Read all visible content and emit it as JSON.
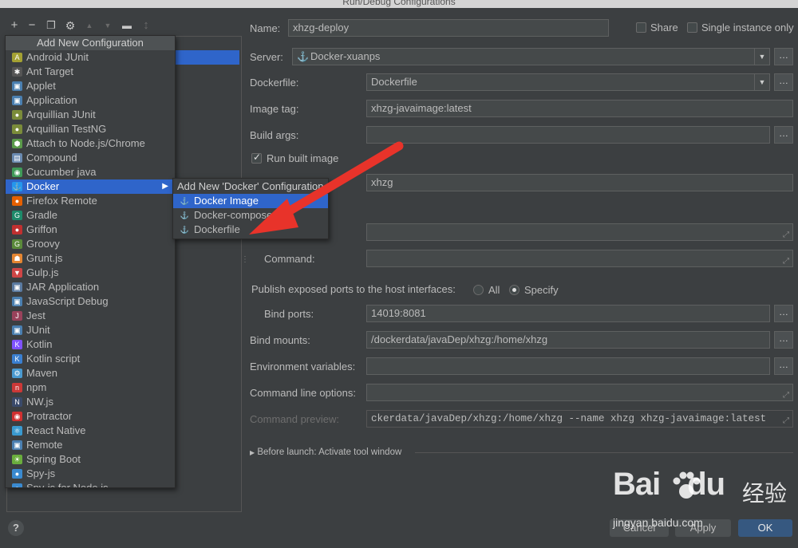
{
  "window": {
    "title": "Run/Debug Configurations"
  },
  "toolbar": {
    "items": [
      {
        "name": "add-icon",
        "glyph": "+"
      },
      {
        "name": "remove-icon",
        "glyph": "−"
      },
      {
        "name": "copy-icon",
        "glyph": "❐"
      },
      {
        "name": "wrench-icon",
        "glyph": "⚙"
      },
      {
        "name": "arrow-up-icon",
        "glyph": "▲"
      },
      {
        "name": "arrow-down-icon",
        "glyph": "▼"
      },
      {
        "name": "folder-icon",
        "glyph": "▬"
      },
      {
        "name": "sort-icon",
        "glyph": "↕"
      }
    ]
  },
  "popup": {
    "header": "Add New Configuration",
    "items": [
      {
        "label": "Android JUnit",
        "icon": "android-junit-icon",
        "color": "#a4a133",
        "glyph": "A"
      },
      {
        "label": "Ant Target",
        "icon": "ant-icon",
        "color": "#555555",
        "glyph": "✱"
      },
      {
        "label": "Applet",
        "icon": "applet-icon",
        "color": "#4a7fb0",
        "glyph": "▣"
      },
      {
        "label": "Application",
        "icon": "application-icon",
        "color": "#4a7fb0",
        "glyph": "▣"
      },
      {
        "label": "Arquillian JUnit",
        "icon": "arquillian-icon",
        "color": "#7b8c3a",
        "glyph": "●"
      },
      {
        "label": "Arquillian TestNG",
        "icon": "arquillian-testng-icon",
        "color": "#7b8c3a",
        "glyph": "●"
      },
      {
        "label": "Attach to Node.js/Chrome",
        "icon": "nodejs-icon",
        "color": "#5a9a4a",
        "glyph": "⬢"
      },
      {
        "label": "Compound",
        "icon": "compound-icon",
        "color": "#6a8ab0",
        "glyph": "▤"
      },
      {
        "label": "Cucumber java",
        "icon": "cucumber-icon",
        "color": "#3f9a58",
        "glyph": "◉"
      },
      {
        "label": "Docker",
        "icon": "docker-icon",
        "color": "#2496ed",
        "glyph": "⚓",
        "selected": true,
        "hasSubmenu": true
      },
      {
        "label": "Firefox Remote",
        "icon": "firefox-icon",
        "color": "#e66000",
        "glyph": "●"
      },
      {
        "label": "Gradle",
        "icon": "gradle-icon",
        "color": "#1d8a6a",
        "glyph": "G"
      },
      {
        "label": "Griffon",
        "icon": "griffon-icon",
        "color": "#c03030",
        "glyph": "●"
      },
      {
        "label": "Groovy",
        "icon": "groovy-icon",
        "color": "#5a8a3a",
        "glyph": "G"
      },
      {
        "label": "Grunt.js",
        "icon": "grunt-icon",
        "color": "#e48632",
        "glyph": "☗"
      },
      {
        "label": "Gulp.js",
        "icon": "gulp-icon",
        "color": "#cf4646",
        "glyph": "▼"
      },
      {
        "label": "JAR Application",
        "icon": "jar-icon",
        "color": "#5a7aa0",
        "glyph": "▣"
      },
      {
        "label": "JavaScript Debug",
        "icon": "js-debug-icon",
        "color": "#4a7fb0",
        "glyph": "▣"
      },
      {
        "label": "Jest",
        "icon": "jest-icon",
        "color": "#99425b",
        "glyph": "J"
      },
      {
        "label": "JUnit",
        "icon": "junit-icon",
        "color": "#4a7fb0",
        "glyph": "▣"
      },
      {
        "label": "Kotlin",
        "icon": "kotlin-icon",
        "color": "#7f52ff",
        "glyph": "K"
      },
      {
        "label": "Kotlin script",
        "icon": "kotlin-script-icon",
        "color": "#3a7fd0",
        "glyph": "K"
      },
      {
        "label": "Maven",
        "icon": "maven-icon",
        "color": "#4a9ad0",
        "glyph": "⚙"
      },
      {
        "label": "npm",
        "icon": "npm-icon",
        "color": "#cb3837",
        "glyph": "n"
      },
      {
        "label": "NW.js",
        "icon": "nwjs-icon",
        "color": "#3a4a6a",
        "glyph": "N"
      },
      {
        "label": "Protractor",
        "icon": "protractor-icon",
        "color": "#d03030",
        "glyph": "◉"
      },
      {
        "label": "React Native",
        "icon": "react-icon",
        "color": "#3a9ad0",
        "glyph": "⚛"
      },
      {
        "label": "Remote",
        "icon": "remote-icon",
        "color": "#4a7fb0",
        "glyph": "▣"
      },
      {
        "label": "Spring Boot",
        "icon": "spring-boot-icon",
        "color": "#6aad3d",
        "glyph": "☀"
      },
      {
        "label": "Spy-js",
        "icon": "spyjs-icon",
        "color": "#3a8ad0",
        "glyph": "●"
      },
      {
        "label": "Spy-js for Node.js",
        "icon": "spyjs-node-icon",
        "color": "#3a8ad0",
        "glyph": "●"
      }
    ]
  },
  "submenu": {
    "header": "Add New 'Docker' Configuration",
    "items": [
      {
        "label": "Docker Image",
        "selected": true
      },
      {
        "label": "Docker-compose",
        "selected": false
      },
      {
        "label": "Dockerfile",
        "selected": false
      }
    ]
  },
  "form": {
    "name_label": "Name:",
    "name_value": "xhzg-deploy",
    "share_label": "Share",
    "single_instance_label": "Single instance only",
    "server_label": "Server:",
    "server_value": "Docker-xuanps",
    "dockerfile_label": "Dockerfile:",
    "dockerfile_value": "Dockerfile",
    "image_tag_label": "Image tag:",
    "image_tag_value": "xhzg-javaimage:latest",
    "build_args_label": "Build args:",
    "build_args_value": "",
    "run_built_image_label": "Run built image",
    "run_built_image_checked": true,
    "container_name_value": "xhzg",
    "entrypoint_value": "",
    "command_label": "Command:",
    "command_value": "",
    "publish_label": "Publish exposed ports to the host interfaces:",
    "publish_all_label": "All",
    "publish_specify_label": "Specify",
    "publish_selected": "Specify",
    "bind_ports_label": "Bind ports:",
    "bind_ports_value": "14019:8081",
    "bind_mounts_label": "Bind mounts:",
    "bind_mounts_value": "/dockerdata/javaDep/xhzg:/home/xhzg",
    "env_vars_label": "Environment variables:",
    "env_vars_value": "",
    "cmd_options_label": "Command line options:",
    "cmd_options_value": "",
    "cmd_preview_label": "Command preview:",
    "cmd_preview_value": "ckerdata/javaDep/xhzg:/home/xhzg --name xhzg xhzg-javaimage:latest",
    "before_launch_label": "Before launch: Activate tool window"
  },
  "buttons": {
    "cancel": "Cancel",
    "apply": "Apply",
    "ok": "OK"
  },
  "colors": {
    "background": "#3c3f41",
    "selection": "#2f65ca",
    "arrow": "#e8332a",
    "primary_button": "#365880"
  },
  "watermark": {
    "brand_left": "Bai",
    "brand_right": "du",
    "brand_cn": "经验",
    "url": "jingyan.baidu.com"
  }
}
